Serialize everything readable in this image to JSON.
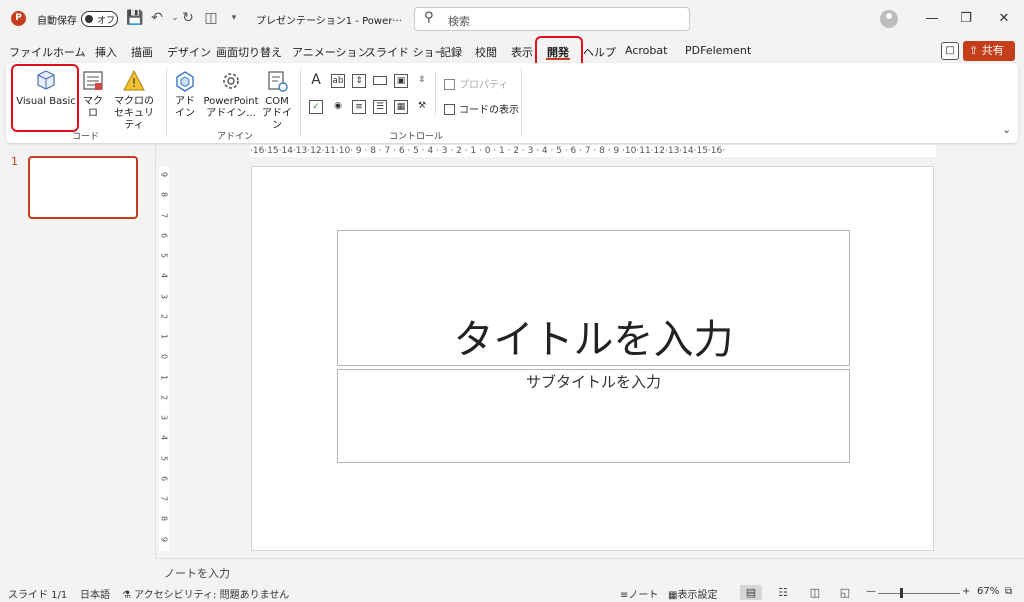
{
  "titlebar": {
    "autosave_label": "自動保存",
    "toggle_text": "オフ",
    "doc_title": "プレゼンテーション1  -  Power···",
    "search_placeholder": "検索"
  },
  "tabs": [
    {
      "label": "ファイル"
    },
    {
      "label": "ホーム"
    },
    {
      "label": "挿入"
    },
    {
      "label": "描画"
    },
    {
      "label": "デザイン"
    },
    {
      "label": "画面切り替え"
    },
    {
      "label": "アニメーション"
    },
    {
      "label": "スライド ショー"
    },
    {
      "label": "記録"
    },
    {
      "label": "校閲"
    },
    {
      "label": "表示"
    },
    {
      "label": "開発"
    },
    {
      "label": "ヘルプ"
    },
    {
      "label": "Acrobat"
    },
    {
      "label": "PDFelement"
    }
  ],
  "share_label": "共有",
  "ribbon": {
    "code": {
      "visual_basic": "Visual Basic",
      "macro": "マクロ",
      "macro_security_1": "マクロの",
      "macro_security_2": "セキュリティ",
      "group_label": "コード"
    },
    "addins": {
      "addin_1": "アド",
      "addin_2": "イン",
      "ppt_addin_1": "PowerPoint",
      "ppt_addin_2": "アドイン...",
      "com_addin_1": "COM",
      "com_addin_2": "アドイン",
      "group_label": "アドイン"
    },
    "controls": {
      "properties": "プロパティ",
      "view_code": "コードの表示",
      "group_label": "コントロール"
    }
  },
  "thumbnail": {
    "number": "1"
  },
  "ruler": {
    "horizontal": "·16·15·14·13·12·11·10· 9 · 8 · 7 · 6 · 5 · 4 · 3 · 2 · 1 · 0 · 1 · 2 · 3 · 4 · 5 · 6 · 7 · 8 · 9 ·10·11·12·13·14·15·16·",
    "vertical": [
      "9",
      "8",
      "7",
      "6",
      "5",
      "4",
      "3",
      "2",
      "1",
      "0",
      "1",
      "2",
      "3",
      "4",
      "5",
      "6",
      "7",
      "8",
      "9"
    ]
  },
  "slide": {
    "title_placeholder": "タイトルを入力",
    "subtitle_placeholder": "サブタイトルを入力"
  },
  "notes_placeholder": "ノートを入力",
  "status": {
    "slide_count": "スライド 1/1",
    "language": "日本語",
    "accessibility": "アクセシビリティ: 問題ありません",
    "notes_label": "ノート",
    "display_settings": "表示設定",
    "zoom": "67%"
  },
  "colors": {
    "accent": "#c43e1c",
    "highlight": "#e0111d"
  }
}
